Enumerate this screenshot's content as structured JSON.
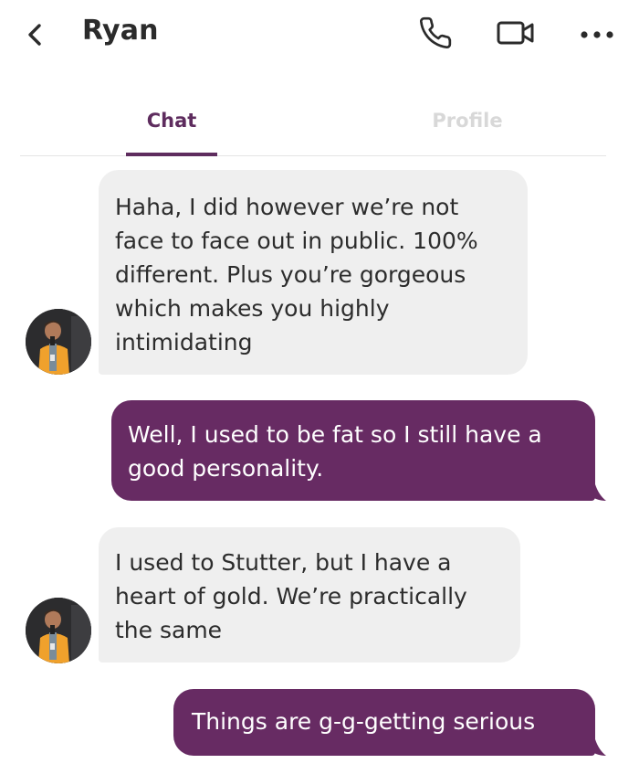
{
  "header": {
    "contact_name": "Ryan",
    "back_icon": "chevron-left-icon",
    "call_icon": "phone-icon",
    "video_icon": "video-camera-icon",
    "more_icon": "more-dots-icon"
  },
  "tabs": [
    {
      "label": "Chat",
      "active": true
    },
    {
      "label": "Profile",
      "active": false
    }
  ],
  "colors": {
    "accent": "#5e2c5e",
    "outgoing_bubble": "#672b63",
    "incoming_bubble": "#efefef",
    "inactive_tab": "#d8d8d8"
  },
  "messages": [
    {
      "from": "Ryan",
      "direction": "incoming",
      "text": "Haha, I did however we’re not face to face out in public. 100% different. Plus you’re gorgeous which makes you highly intimidating"
    },
    {
      "from": "me",
      "direction": "outgoing",
      "text": "Well, I used to be fat so I still have a good personality."
    },
    {
      "from": "Ryan",
      "direction": "incoming",
      "text": "I used to Stutter, but I have a heart of gold. We’re practically the same"
    },
    {
      "from": "me",
      "direction": "outgoing",
      "text": "Things are g-g-getting serious"
    }
  ]
}
